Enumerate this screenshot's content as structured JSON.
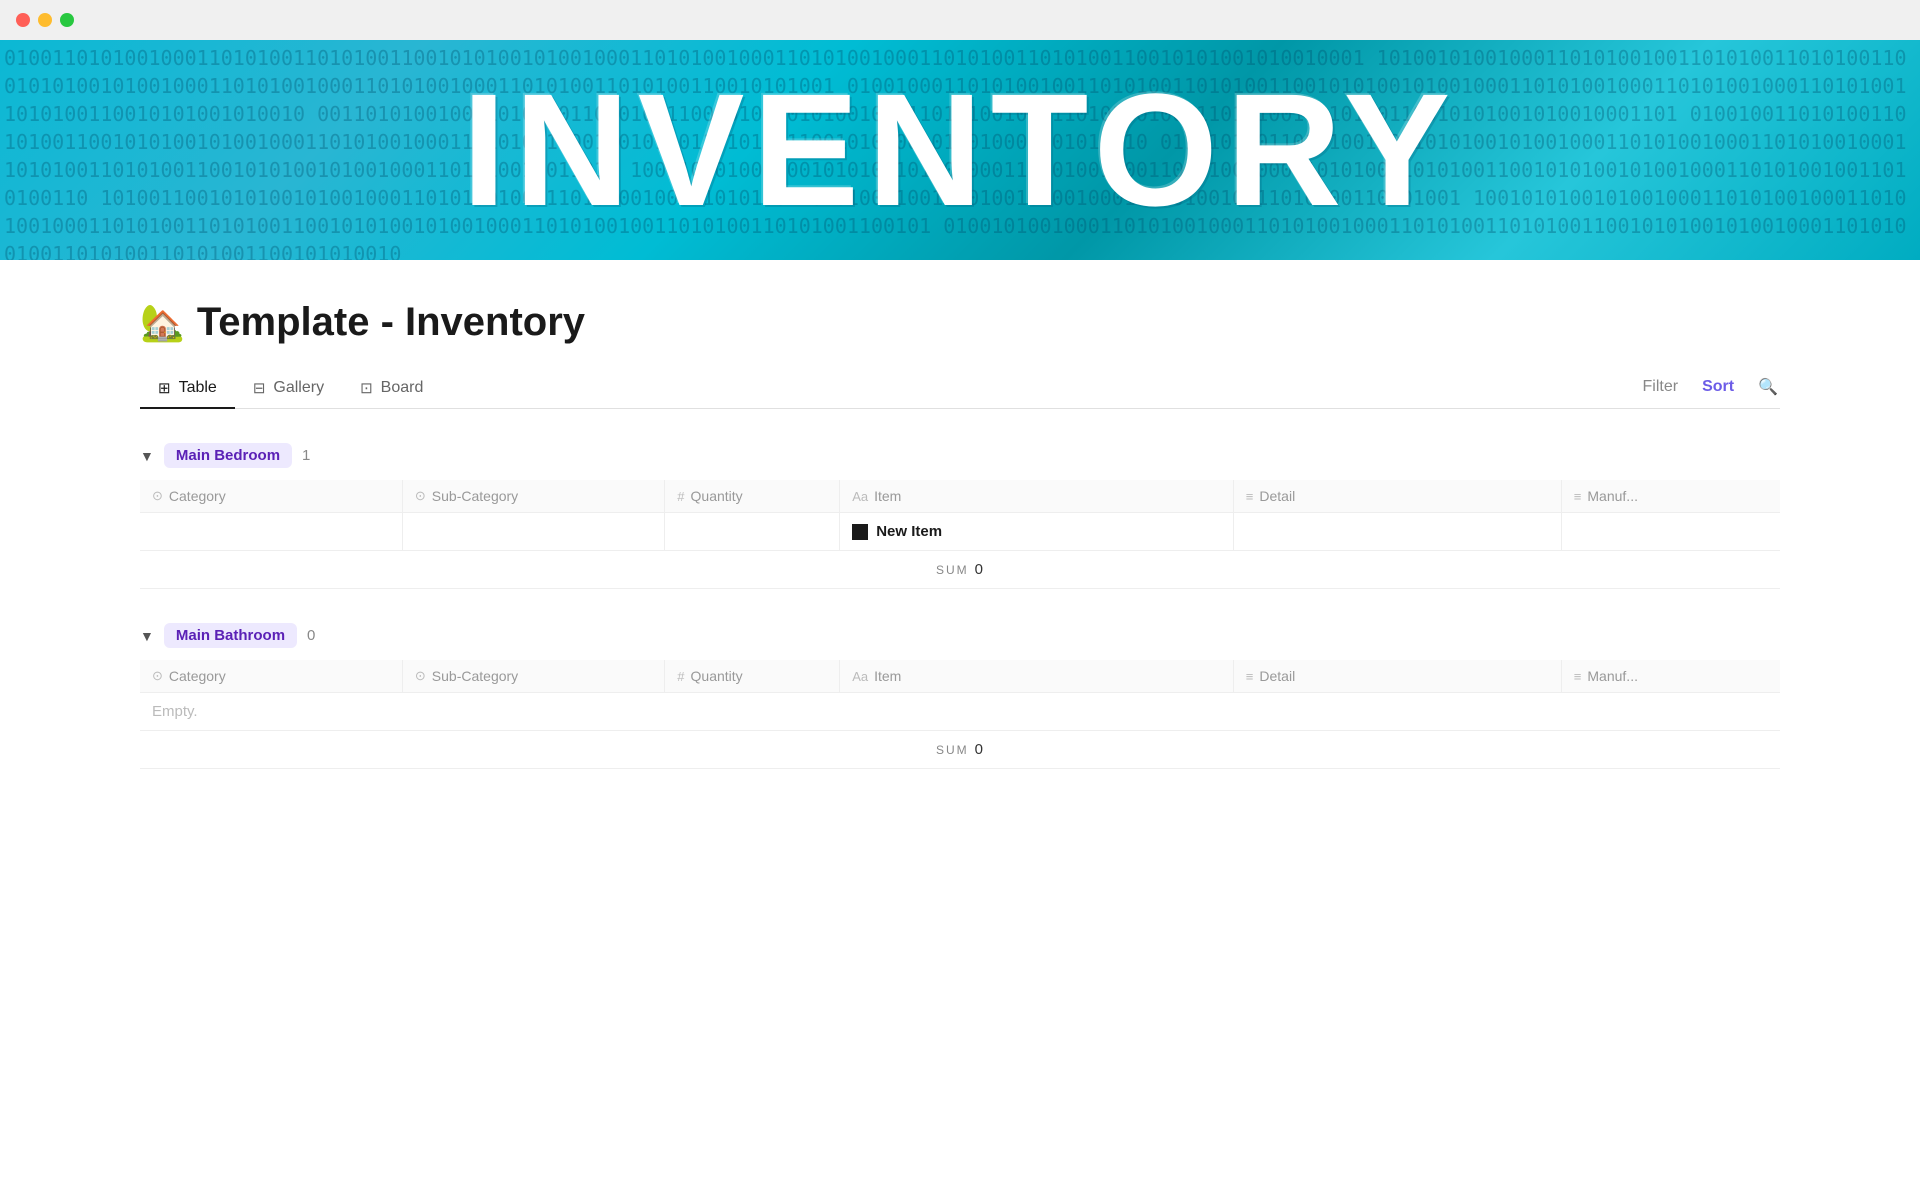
{
  "titlebar": {
    "traffic_lights": [
      "red",
      "yellow",
      "green"
    ]
  },
  "hero": {
    "text": "INVENTORY"
  },
  "page": {
    "emoji": "🏡",
    "title": "Template - Inventory"
  },
  "tabs": {
    "items": [
      {
        "label": "Table",
        "icon": "table-icon",
        "active": true
      },
      {
        "label": "Gallery",
        "icon": "gallery-icon",
        "active": false
      },
      {
        "label": "Board",
        "icon": "board-icon",
        "active": false
      }
    ]
  },
  "toolbar": {
    "filter_label": "Filter",
    "sort_label": "Sort",
    "search_icon": "search-icon"
  },
  "groups": [
    {
      "id": "main-bedroom",
      "label": "Main Bedroom",
      "count": "1",
      "columns": [
        {
          "icon": "circle-down-icon",
          "label": "Category"
        },
        {
          "icon": "circle-down-icon",
          "label": "Sub-Category"
        },
        {
          "icon": "hash-icon",
          "label": "Quantity"
        },
        {
          "icon": "text-icon",
          "label": "Item"
        },
        {
          "icon": "lines-icon",
          "label": "Detail"
        },
        {
          "icon": "lines-icon",
          "label": "Manuf..."
        }
      ],
      "rows": [
        {
          "category": "",
          "subcategory": "",
          "quantity": "",
          "item": "New Item",
          "detail": "",
          "manuf": ""
        }
      ],
      "sum_label": "SUM",
      "sum_value": "0",
      "empty": false
    },
    {
      "id": "main-bathroom",
      "label": "Main Bathroom",
      "count": "0",
      "columns": [
        {
          "icon": "circle-down-icon",
          "label": "Category"
        },
        {
          "icon": "circle-down-icon",
          "label": "Sub-Category"
        },
        {
          "icon": "hash-icon",
          "label": "Quantity"
        },
        {
          "icon": "text-icon",
          "label": "Item"
        },
        {
          "icon": "lines-icon",
          "label": "Detail"
        },
        {
          "icon": "lines-icon",
          "label": "Manuf..."
        }
      ],
      "rows": [],
      "sum_label": "SUM",
      "sum_value": "0",
      "empty": true,
      "empty_text": "Empty."
    }
  ]
}
